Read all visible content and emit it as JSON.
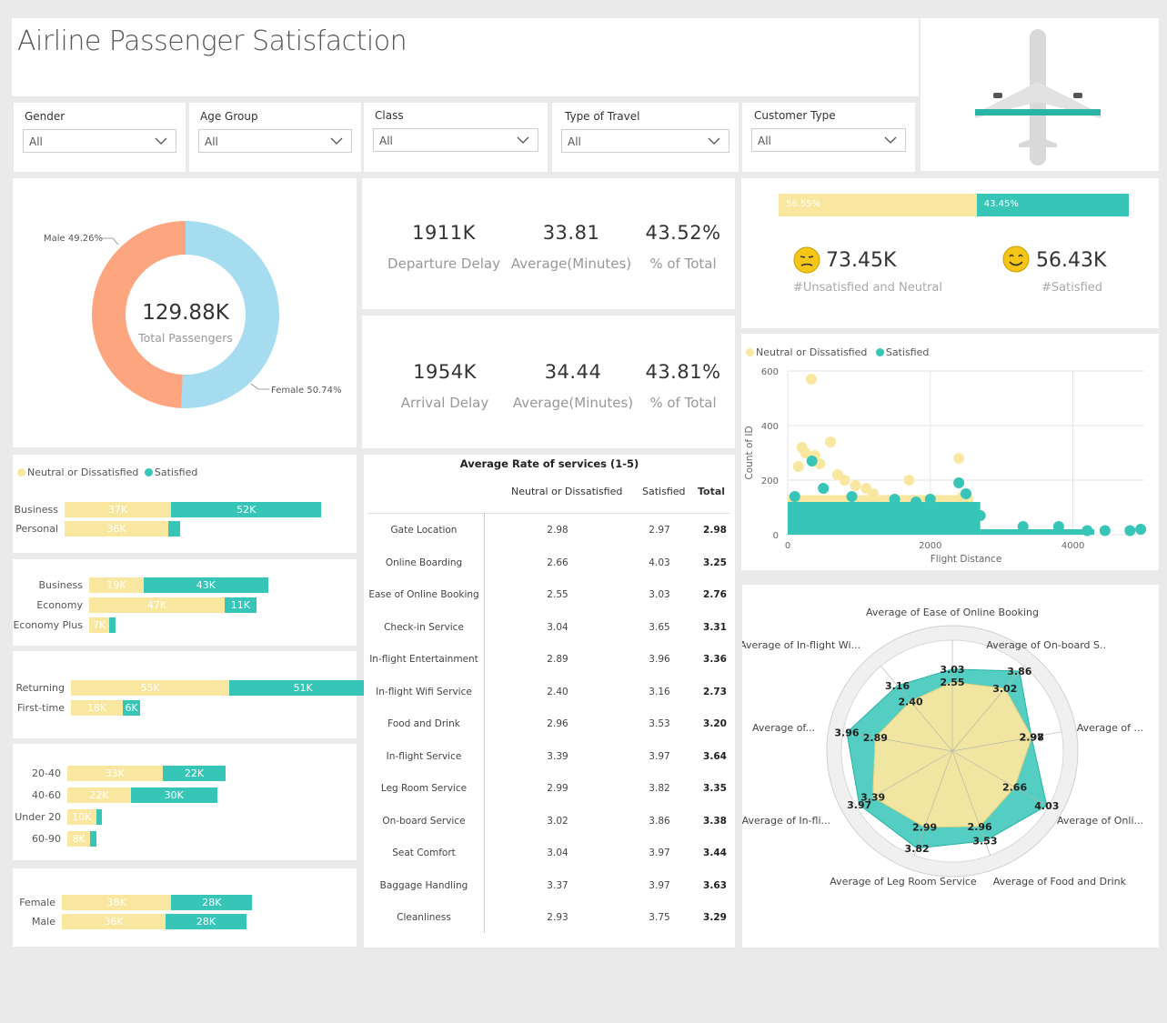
{
  "title": "Airline Passenger Satisfaction",
  "colors": {
    "dissatisfied": "#f9e79f",
    "satisfied": "#36c5b7",
    "male": "#fda57f",
    "female": "#a6dcef"
  },
  "slicers": [
    {
      "label": "Gender",
      "value": "All"
    },
    {
      "label": "Age Group",
      "value": "All"
    },
    {
      "label": "Class",
      "value": "All"
    },
    {
      "label": "Type of Travel",
      "value": "All"
    },
    {
      "label": "Customer Type",
      "value": "All"
    }
  ],
  "donut": {
    "center_value": "129.88K",
    "center_label": "Total Passengers",
    "male_label": "Male 49.26%",
    "female_label": "Female 50.74%"
  },
  "donut_data": {
    "type": "pie",
    "categories": [
      "Male",
      "Female"
    ],
    "values": [
      49.26,
      50.74
    ]
  },
  "departure": {
    "value": "1911K",
    "label": "Departure Delay",
    "avg": "33.81",
    "avg_label": "Average(Minutes)",
    "pct": "43.52%",
    "pct_label": "% of Total"
  },
  "arrival": {
    "value": "1954K",
    "label": "Arrival Delay",
    "avg": "34.44",
    "avg_label": "Average(Minutes)",
    "pct": "43.81%",
    "pct_label": "% of Total"
  },
  "satisfaction": {
    "bar_left": "56.55%",
    "bar_right": "43.45%",
    "bar_fraction": 0.5655,
    "unsat_value": "73.45K",
    "unsat_label": "#Unsatisfied and Neutral",
    "sat_value": "56.43K",
    "sat_label": "#Satisfied"
  },
  "legend": {
    "dissatisfied": "Neutral or Dissatisfied",
    "satisfied": "Satisfied"
  },
  "bar_groups": [
    {
      "rows": [
        {
          "cat": "Business",
          "a": 37,
          "al": "37K",
          "b": 52,
          "bl": "52K"
        },
        {
          "cat": "Personal",
          "a": 36,
          "al": "36K",
          "b": 4,
          "bl": ""
        }
      ]
    },
    {
      "rows": [
        {
          "cat": "Business",
          "a": 19,
          "al": "19K",
          "b": 43,
          "bl": "43K"
        },
        {
          "cat": "Economy",
          "a": 47,
          "al": "47K",
          "b": 11,
          "bl": "11K"
        },
        {
          "cat": "Economy Plus",
          "a": 7,
          "al": "7K",
          "b": 2,
          "bl": ""
        }
      ]
    },
    {
      "rows": [
        {
          "cat": "Returning",
          "a": 55,
          "al": "55K",
          "b": 51,
          "bl": "51K"
        },
        {
          "cat": "First-time",
          "a": 18,
          "al": "18K",
          "b": 6,
          "bl": "6K"
        }
      ]
    },
    {
      "rows": [
        {
          "cat": "20-40",
          "a": 33,
          "al": "33K",
          "b": 22,
          "bl": "22K"
        },
        {
          "cat": "40-60",
          "a": 22,
          "al": "22K",
          "b": 30,
          "bl": "30K"
        },
        {
          "cat": "Under 20",
          "a": 10,
          "al": "10K",
          "b": 2,
          "bl": ""
        },
        {
          "cat": "60-90",
          "a": 8,
          "al": "8K",
          "b": 2,
          "bl": ""
        }
      ]
    },
    {
      "rows": [
        {
          "cat": "Female",
          "a": 38,
          "al": "38K",
          "b": 28,
          "bl": "28K"
        },
        {
          "cat": "Male",
          "a": 36,
          "al": "36K",
          "b": 28,
          "bl": "28K"
        }
      ]
    }
  ],
  "table": {
    "title": "Average Rate of services (1-5)",
    "headers": [
      "Neutral or Dissatisfied",
      "Satisfied",
      "Total"
    ],
    "rows": [
      [
        "Gate Location",
        "2.98",
        "2.97",
        "2.98"
      ],
      [
        "Online Boarding",
        "2.66",
        "4.03",
        "3.25"
      ],
      [
        "Ease of Online Booking",
        "2.55",
        "3.03",
        "2.76"
      ],
      [
        "Check-in Service",
        "3.04",
        "3.65",
        "3.31"
      ],
      [
        "In-flight Entertainment",
        "2.89",
        "3.96",
        "3.36"
      ],
      [
        "In-flight Wifi Service",
        "2.40",
        "3.16",
        "2.73"
      ],
      [
        "Food and Drink",
        "2.96",
        "3.53",
        "3.20"
      ],
      [
        "In-flight Service",
        "3.39",
        "3.97",
        "3.64"
      ],
      [
        "Leg Room Service",
        "2.99",
        "3.82",
        "3.35"
      ],
      [
        "On-board Service",
        "3.02",
        "3.86",
        "3.38"
      ],
      [
        "Seat Comfort",
        "3.04",
        "3.97",
        "3.44"
      ],
      [
        "Baggage Handling",
        "3.37",
        "3.97",
        "3.63"
      ],
      [
        "Cleanliness",
        "2.93",
        "3.75",
        "3.29"
      ]
    ]
  },
  "chart_data": {
    "type": "scatter",
    "xlabel": "Flight Distance",
    "ylabel": "Count of ID",
    "xticks": [
      "0",
      "2000",
      "4000"
    ],
    "yticks": [
      "0",
      "200",
      "400",
      "600"
    ],
    "xlim": [
      0,
      5000
    ],
    "ylim": [
      0,
      600
    ],
    "series": [
      {
        "name": "Neutral or Dissatisfied",
        "points": [
          [
            330,
            570
          ],
          [
            200,
            320
          ],
          [
            250,
            300
          ],
          [
            380,
            290
          ],
          [
            600,
            340
          ],
          [
            150,
            250
          ],
          [
            450,
            260
          ],
          [
            800,
            200
          ],
          [
            950,
            180
          ],
          [
            1200,
            150
          ],
          [
            1700,
            200
          ],
          [
            2000,
            130
          ],
          [
            2400,
            280
          ],
          [
            2450,
            140
          ],
          [
            1100,
            170
          ],
          [
            700,
            220
          ]
        ]
      },
      {
        "name": "Satisfied",
        "points": [
          [
            340,
            270
          ],
          [
            500,
            170
          ],
          [
            900,
            140
          ],
          [
            1500,
            130
          ],
          [
            1800,
            120
          ],
          [
            2400,
            190
          ],
          [
            2500,
            150
          ],
          [
            2700,
            70
          ],
          [
            3300,
            30
          ],
          [
            3800,
            30
          ],
          [
            4200,
            15
          ],
          [
            4450,
            15
          ],
          [
            4800,
            15
          ],
          [
            4950,
            20
          ],
          [
            100,
            140
          ],
          [
            2000,
            130
          ]
        ]
      }
    ]
  },
  "radar": {
    "labels": [
      "Average of Ease of Online Booking",
      "Average of On-board S..",
      "Average of ...",
      "Average of Onli...",
      "Average of Food and Drink",
      "Average of Leg Room Service",
      "Average of In-fli...",
      "Average of...",
      "Average of In-flight Wi..."
    ],
    "inner": [
      2.55,
      3.02,
      2.98,
      2.66,
      2.96,
      2.99,
      3.39,
      2.89,
      2.4
    ],
    "outer": [
      3.03,
      3.86,
      2.97,
      4.03,
      3.53,
      3.82,
      3.97,
      3.96,
      3.16
    ],
    "inner_labels": [
      "2.55",
      "3.02",
      "2.98",
      "2.66",
      "2.96",
      "2.99",
      "3.39",
      "2.89",
      "2.40"
    ],
    "outer_labels": [
      "3.03",
      "3.86",
      "2.97",
      "4.03",
      "3.53",
      "3.82",
      "3.97",
      "3.96",
      "3.16"
    ]
  }
}
